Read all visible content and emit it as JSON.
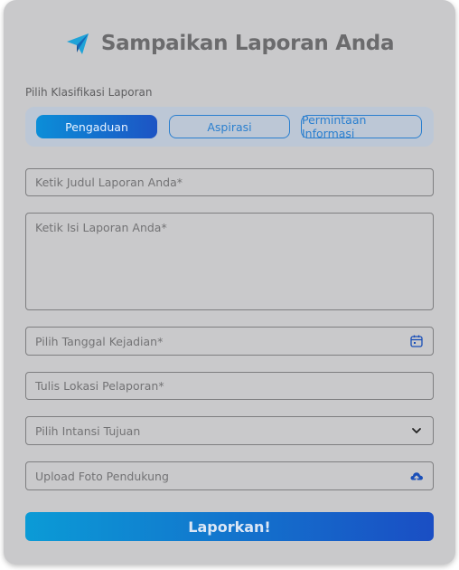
{
  "header": {
    "title": "Sampaikan Laporan Anda",
    "logo_icon": "paper-plane-icon"
  },
  "classification": {
    "label": "Pilih Klasifikasi Laporan",
    "tabs": [
      {
        "label": "Pengaduan",
        "active": true
      },
      {
        "label": "Aspirasi",
        "active": false
      },
      {
        "label": "Permintaan Informasi",
        "active": false
      }
    ]
  },
  "form": {
    "title_placeholder": "Ketik Judul Laporan Anda*",
    "content_placeholder": "Ketik Isi Laporan Anda*",
    "date_placeholder": "Pilih Tanggal Kejadian*",
    "date_icon": "calendar-icon",
    "location_placeholder": "Tulis Lokasi Pelaporan*",
    "agency_placeholder": "Pilih Intansi Tujuan",
    "agency_icon": "chevron-down-icon",
    "upload_placeholder": "Upload Foto Pendukung",
    "upload_icon": "cloud-upload-icon"
  },
  "submit_label": "Laporkan!",
  "colors": {
    "accent": "#1a6fd0",
    "card": "#c9c9cb",
    "text_muted": "#737375"
  }
}
